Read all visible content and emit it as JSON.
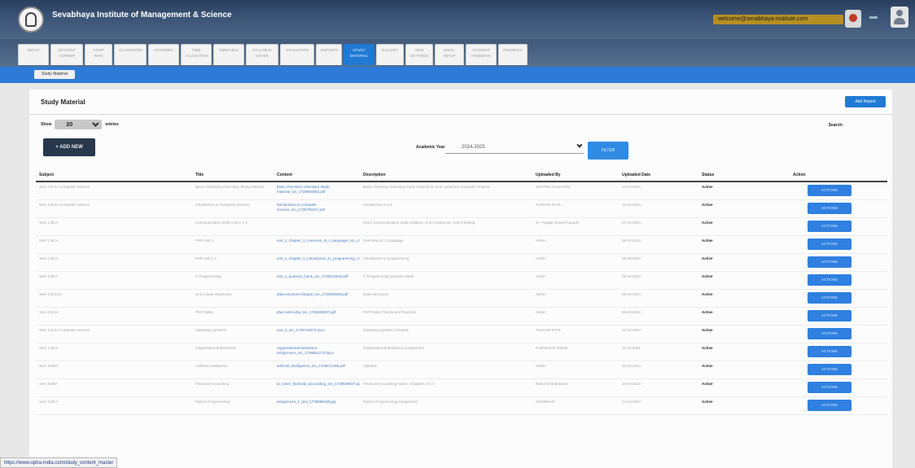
{
  "header": {
    "institute_name": "Sevabhaya Institute of Management & Science",
    "user_label": "welcome@sevabhaya-institute.com"
  },
  "nav": {
    "tabs": [
      {
        "label": "SETUP"
      },
      {
        "label": "STUDENT CORNER"
      },
      {
        "label": "STAFF INFO"
      },
      {
        "label": "CLASSROOM"
      },
      {
        "label": "ACADEMIC"
      },
      {
        "label": "TIME ALLOCATION"
      },
      {
        "label": "TIMETABLE"
      },
      {
        "label": "SYLLABUS COVER"
      },
      {
        "label": "EVALUATION"
      },
      {
        "label": "REPORTS"
      },
      {
        "label": "STUDY MATERIAL"
      },
      {
        "label": "GALLERY"
      },
      {
        "label": "WEB SETTINGS"
      },
      {
        "label": "EMAIL SETUP"
      },
      {
        "label": "STUDENT FEEDBACK"
      },
      {
        "label": "FEEDBACK"
      }
    ],
    "active_index": 10
  },
  "subnav": {
    "button_label": "Study Material"
  },
  "page": {
    "title": "Study Material",
    "top_button": "Add Report",
    "show_label": "Show",
    "entries_value": "20",
    "entries_label": "entries",
    "search_label": "Search:",
    "add_button": "+ ADD NEW",
    "academic_year_label": "Academic Year",
    "academic_year_value": "2024-2025",
    "filter_button": "FILTER"
  },
  "table": {
    "headers": [
      "Subject",
      "Title",
      "Content",
      "Description",
      "Uploaded By",
      "Uploaded Date",
      "Status",
      "Action"
    ],
    "rows": [
      [
        "Sem 3 B.Sc Computer Science",
        "Basic Chemistry Chemistry Study Material",
        "basic-chemistry-chemistry-study-material_sm_1728884063.pdf",
        "Basic chemistry chemistry study material for B.Sc semester Computer Science",
        "SHARMA KULKARNI",
        "14-10-2024",
        "Active",
        "ACTIONS"
      ],
      [
        "Sem 3 B.Sc Computer Science",
        "Introduction to Computer Science",
        "introduction-to-computer-science_sm_1728703347.pdf",
        "Introduction to CS",
        "TUSHAR PATIL",
        "12-10-2024",
        "Active",
        "ACTIONS"
      ],
      [
        "Sem 1 BCA",
        "Communication Skills Unit 1 2 3",
        "",
        "Unit 1 Communication Skills syllabus, Unit 2 Grammar, Unit 3 Writing",
        "Dr. Pragati Vinod Khopade",
        "07-10-2024",
        "Active",
        "ACTIONS"
      ],
      [
        "Sem 1 BCA",
        "PHP Unit 1",
        "unit_1_chapter_2_overview_of_c_language_sm_1728412771.pptx",
        "Overview of C Language",
        "Admin",
        "08-10-2024",
        "Active",
        "ACTIONS"
      ],
      [
        "Sem 1 BCA",
        "PHP Unit 1 2",
        "unit_1_chapter_1_introduction_to_programming_concepts_sm_1728412829.pptx",
        "Introduction to programming",
        "Admin",
        "08-10-2024",
        "Active",
        "ACTIONS"
      ],
      [
        "Sem 1 BCA",
        "C Programming",
        "unit_1_question_bank_sm_1728410632.pdf",
        "C Programming Question Bank",
        "Admin",
        "08-10-2024",
        "Active",
        "ACTIONS"
      ],
      [
        "Sem 3 B.Com",
        "Unit 1 Data Structures",
        "data-structure-integral_sm_1728408838.pdf",
        "Data Structures",
        "Admin",
        "08-10-2024",
        "Active",
        "ACTIONS"
      ],
      [
        "Sem 3 BCA",
        "PHP Notes",
        "php-notes-php_sm_1728408237.pdf",
        "PHP Notes Theory and Practical",
        "Admin",
        "08-10-2024",
        "Active",
        "ACTIONS"
      ],
      [
        "Sem 3 B.Sc Computer Science",
        "Operating Systems",
        "unit_2_sm_1728716072.docx",
        "Operating System Concepts",
        "TUSHAR PATIL",
        "12-10-2024",
        "Active",
        "ACTIONS"
      ],
      [
        "Sem 1 BCA",
        "Organisational Behaviour",
        "organisational-behaviour-assignment_sm_1728661273.docx",
        "Organisational Behaviour Assignment",
        "Prathamesh Shinde",
        "11-10-2024",
        "Active",
        "ACTIONS"
      ],
      [
        "Sem 3 BBA",
        "Artificial Intelligence",
        "artificial_intelligence_sm_1728571468.pdf",
        "Syllabus",
        "Admin",
        "10-10-2024",
        "Active",
        "ACTIONS"
      ],
      [
        "Sem 3 BBA",
        "Financial Accounting",
        "ai_notes_financial_accounting_sm_1728548047.pptx",
        "Financial Accounting Notes, Chapters 1 to 4",
        "Rahul Chandrakant",
        "10-10-2024",
        "Active",
        "ACTIONS"
      ],
      [
        "Sem 3 BCA",
        "Python Programming",
        "assignment_1_bca_1728886190.jpg",
        "Python Programming Assignment",
        "SHRIDHAR",
        "14-10-2024",
        "Active",
        "ACTIONS"
      ]
    ]
  },
  "status_bar": {
    "url": "https://www.optra-india.com/study_content_master"
  }
}
